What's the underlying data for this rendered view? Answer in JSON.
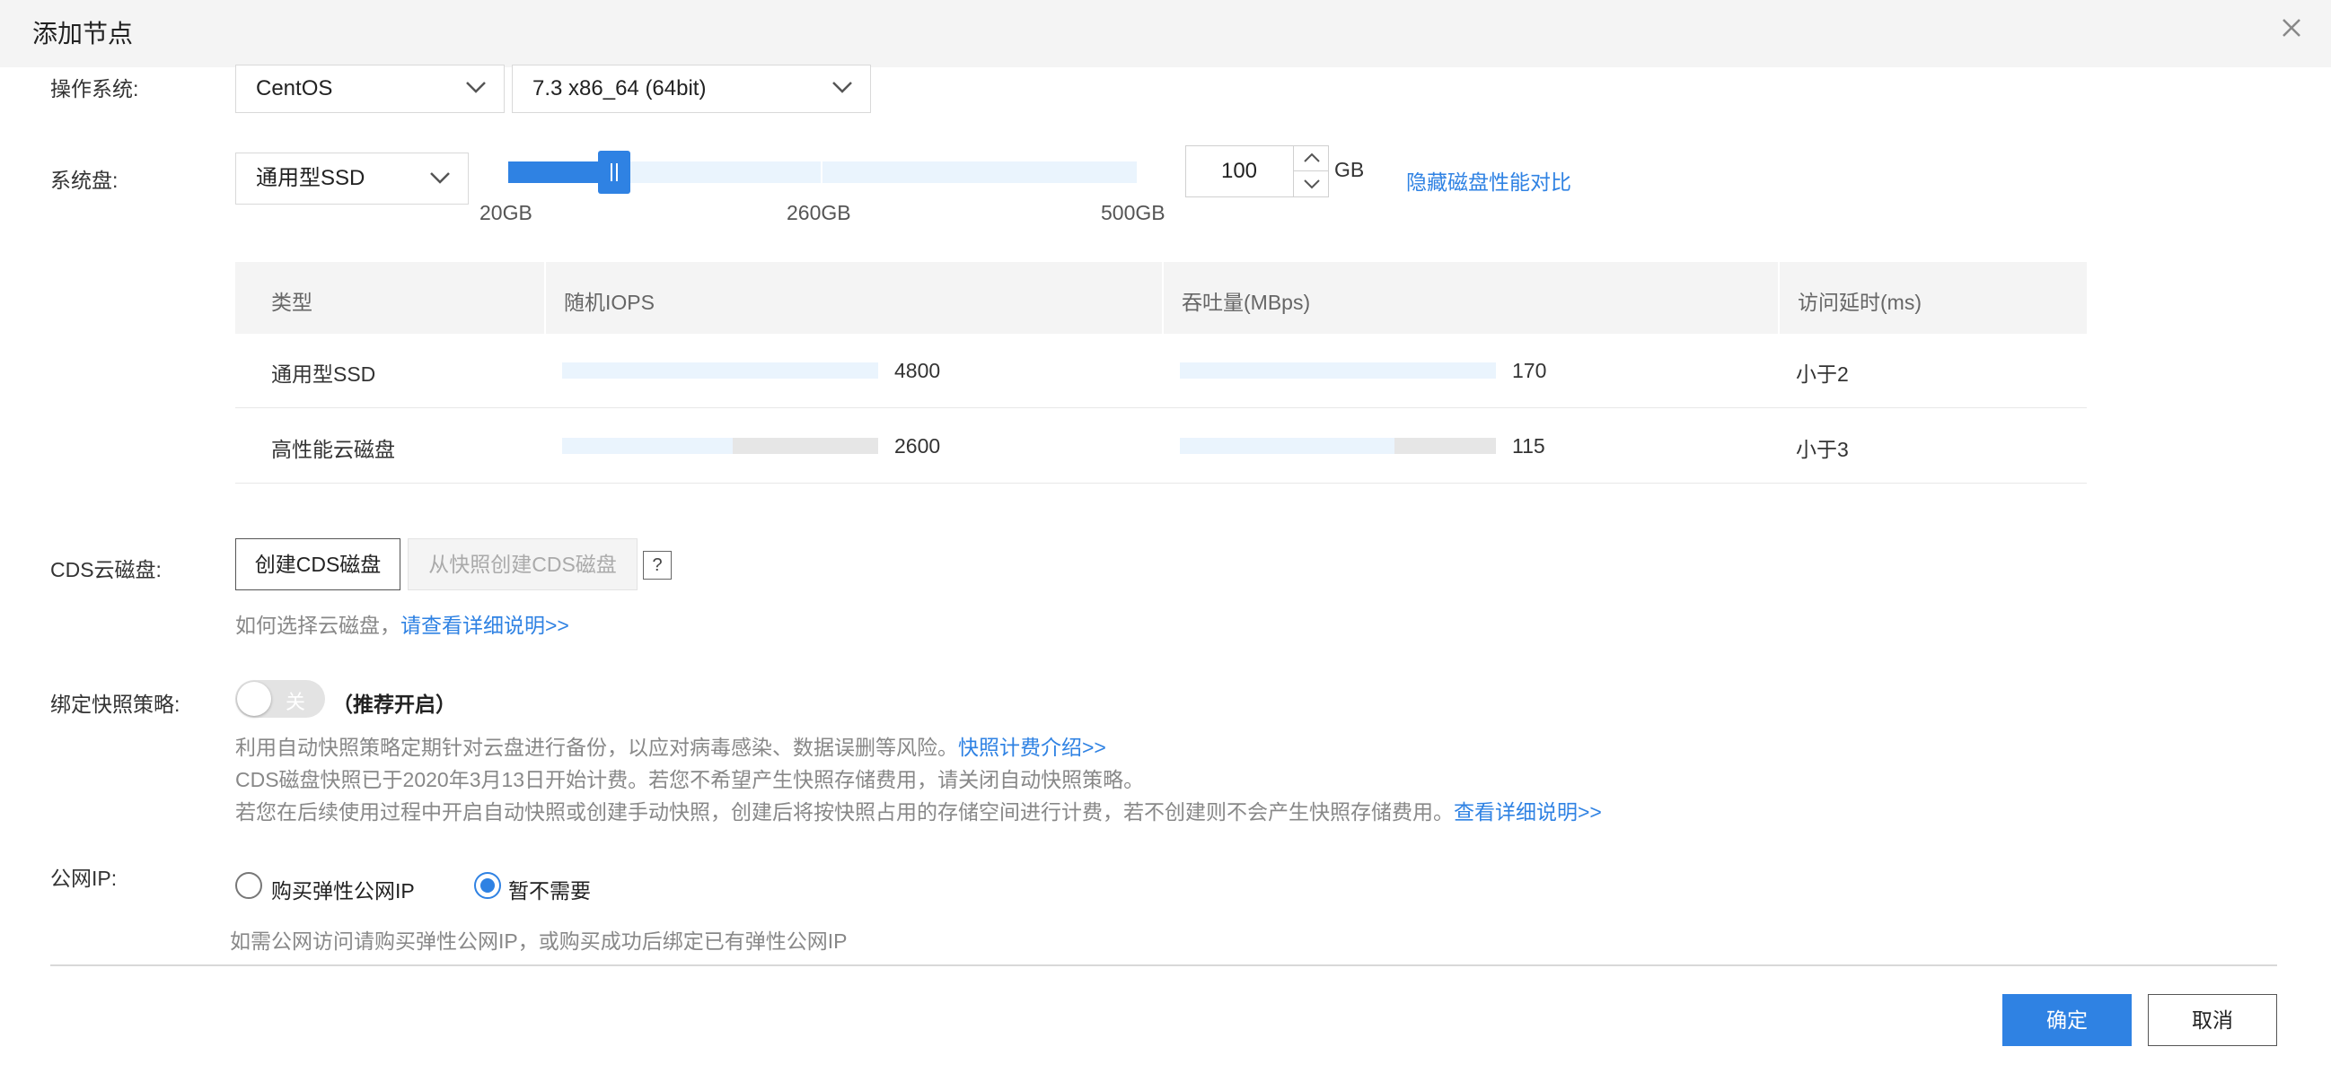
{
  "dialog": {
    "title": "添加节点"
  },
  "os": {
    "label": "操作系统:",
    "type": "CentOS",
    "version": "7.3 x86_64 (64bit)"
  },
  "system_disk": {
    "label": "系统盘:",
    "type": "通用型SSD",
    "slider": {
      "ticks": [
        "20GB",
        "260GB",
        "500GB"
      ],
      "min_gb": 20,
      "max_gb": 500,
      "value_gb": 100
    },
    "size_value": "100",
    "unit": "GB",
    "toggle_compare_link": "隐藏磁盘性能对比"
  },
  "perf_table": {
    "headers": [
      "类型",
      "随机IOPS",
      "吞吐量(MBps)",
      "访问延时(ms)"
    ],
    "rows": [
      {
        "type": "通用型SSD",
        "iops": "4800",
        "iops_fraction": 1.0,
        "throughput": "170",
        "throughput_fraction": 1.0,
        "latency": "小于2"
      },
      {
        "type": "高性能云磁盘",
        "iops": "2600",
        "iops_fraction": 0.54,
        "throughput": "115",
        "throughput_fraction": 0.68,
        "latency": "小于3"
      }
    ]
  },
  "cds": {
    "label": "CDS云磁盘:",
    "create_button": "创建CDS磁盘",
    "from_snapshot_button": "从快照创建CDS磁盘",
    "help": "?",
    "hint_prefix": "如何选择云磁盘，",
    "hint_link": "请查看详细说明>>"
  },
  "snapshot": {
    "label": "绑定快照策略:",
    "toggle_state": "关",
    "recommend": "（推荐开启）",
    "line1": "利用自动快照策略定期针对云盘进行备份，以应对病毒感染、数据误删等风险。",
    "line1_link": "快照计费介绍>>",
    "line2": "CDS磁盘快照已于2020年3月13日开始计费。若您不希望产生快照存储费用，请关闭自动快照策略。",
    "line3": "若您在后续使用过程中开启自动快照或创建手动快照，创建后将按快照占用的存储空间进行计费，若不创建则不会产生快照存储费用。",
    "line3_link": "查看详细说明>>"
  },
  "public_ip": {
    "label": "公网IP:",
    "options": [
      "购买弹性公网IP",
      "暂不需要"
    ],
    "selected": "暂不需要",
    "hint": "如需公网访问请购买弹性公网IP，或购买成功后绑定已有弹性公网IP"
  },
  "footer": {
    "confirm": "确定",
    "cancel": "取消"
  },
  "colors": {
    "accent": "#2f82e3",
    "bar_light": "#eaf4fd"
  },
  "icons": {
    "close": "close-icon",
    "dropdown": "chevron-down-icon",
    "spin_up": "chevron-up-icon",
    "spin_down": "chevron-down-icon"
  }
}
